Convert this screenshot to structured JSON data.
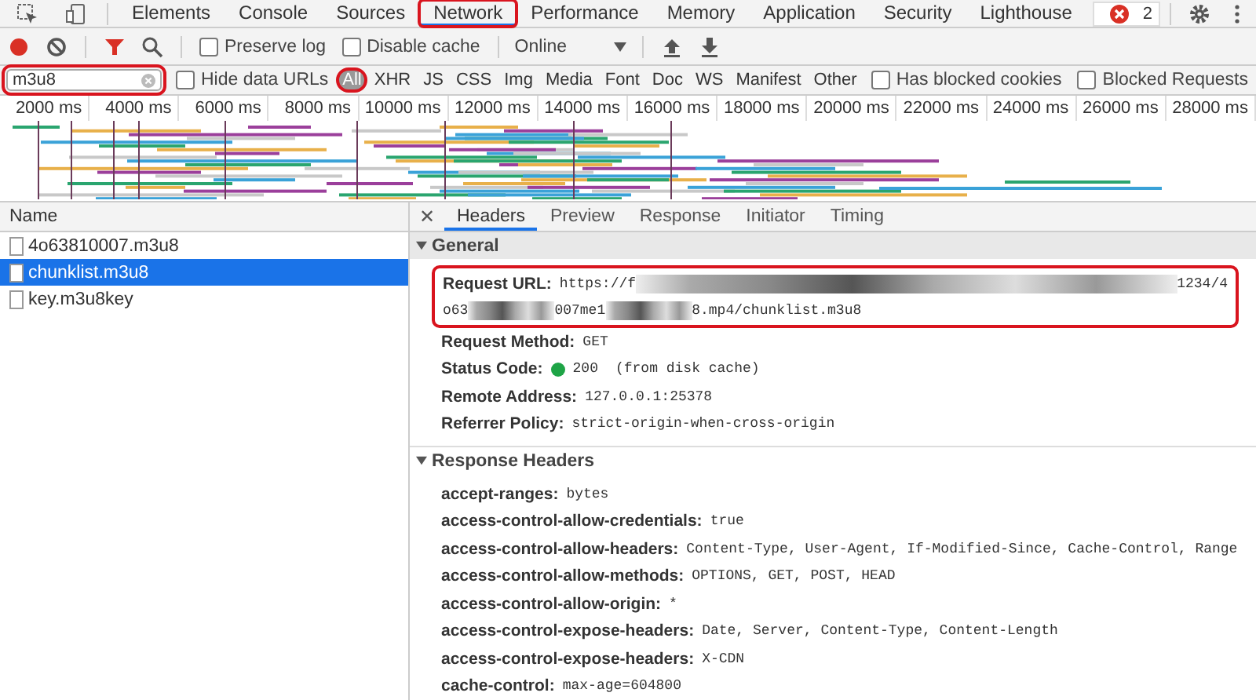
{
  "top_tabs": [
    {
      "label": "Elements",
      "selected": false,
      "annotated": false
    },
    {
      "label": "Console",
      "selected": false,
      "annotated": false
    },
    {
      "label": "Sources",
      "selected": false,
      "annotated": false
    },
    {
      "label": "Network",
      "selected": true,
      "annotated": true
    },
    {
      "label": "Performance",
      "selected": false,
      "annotated": false
    },
    {
      "label": "Memory",
      "selected": false,
      "annotated": false
    },
    {
      "label": "Application",
      "selected": false,
      "annotated": false
    },
    {
      "label": "Security",
      "selected": false,
      "annotated": false
    },
    {
      "label": "Lighthouse",
      "selected": false,
      "annotated": false
    }
  ],
  "error_badge": {
    "count": "2"
  },
  "toolbar": {
    "recording": true,
    "filter_active": true,
    "checkboxes": [
      {
        "label": "Preserve log",
        "checked": false
      },
      {
        "label": "Disable cache",
        "checked": false
      }
    ],
    "throttling": "Online"
  },
  "filter_bar": {
    "value": "m3u8",
    "annotated": true,
    "hide_data_urls": {
      "label": "Hide data URLs",
      "checked": false
    },
    "types": [
      {
        "label": "All",
        "selected": true,
        "annotated": true
      },
      {
        "label": "XHR",
        "selected": false,
        "annotated": false
      },
      {
        "label": "JS",
        "selected": false,
        "annotated": false
      },
      {
        "label": "CSS",
        "selected": false,
        "annotated": false
      },
      {
        "label": "Img",
        "selected": false,
        "annotated": false
      },
      {
        "label": "Media",
        "selected": false,
        "annotated": false
      },
      {
        "label": "Font",
        "selected": false,
        "annotated": false
      },
      {
        "label": "Doc",
        "selected": false,
        "annotated": false
      },
      {
        "label": "WS",
        "selected": false,
        "annotated": false
      },
      {
        "label": "Manifest",
        "selected": false,
        "annotated": false
      },
      {
        "label": "Other",
        "selected": false,
        "annotated": false
      }
    ],
    "checkboxes": [
      {
        "label": "Has blocked cookies",
        "checked": false
      },
      {
        "label": "Blocked Requests",
        "checked": false
      }
    ]
  },
  "timeline": {
    "ticks": [
      "2000 ms",
      "4000 ms",
      "6000 ms",
      "8000 ms",
      "10000 ms",
      "12000 ms",
      "14000 ms",
      "16000 ms",
      "18000 ms",
      "20000 ms",
      "22000 ms",
      "24000 ms",
      "26000 ms",
      "28000 ms"
    ]
  },
  "requests": {
    "column": "Name",
    "rows": [
      {
        "name": "4o63810007.m3u8",
        "selected": false
      },
      {
        "name": "chunklist.m3u8",
        "selected": true
      },
      {
        "name": "key.m3u8key",
        "selected": false
      }
    ]
  },
  "detail": {
    "close_label": "✕",
    "tabs": [
      {
        "label": "Headers",
        "selected": true
      },
      {
        "label": "Preview",
        "selected": false
      },
      {
        "label": "Response",
        "selected": false
      },
      {
        "label": "Initiator",
        "selected": false
      },
      {
        "label": "Timing",
        "selected": false
      }
    ],
    "sections": [
      {
        "title": "General",
        "expanded": true,
        "rows": [
          {
            "kind": "url",
            "key": "Request URL:",
            "annotated": true,
            "lines": [
              [
                {
                  "kind": "text",
                  "text": "https://f"
                },
                {
                  "kind": "redacted"
                },
                {
                  "kind": "text",
                  "text": "1234/4"
                }
              ],
              [
                {
                  "kind": "text",
                  "text": "o63"
                },
                {
                  "kind": "redacted"
                },
                {
                  "kind": "text",
                  "text": "007me1"
                },
                {
                  "kind": "redacted"
                },
                {
                  "kind": "text",
                  "text": "8.mp4/chunklist.m3u8"
                }
              ]
            ]
          },
          {
            "kind": "plain",
            "key": "Request Method:",
            "value": "GET"
          },
          {
            "kind": "status",
            "key": "Status Code:",
            "value": "200",
            "note": "(from disk cache)",
            "color": "#1ea446"
          },
          {
            "kind": "plain",
            "key": "Remote Address:",
            "value": "127.0.0.1:25378"
          },
          {
            "kind": "plain",
            "key": "Referrer Policy:",
            "value": "strict-origin-when-cross-origin"
          }
        ]
      },
      {
        "title": "Response Headers",
        "expanded": true,
        "rows": [
          {
            "kind": "plain",
            "key": "accept-ranges:",
            "value": "bytes"
          },
          {
            "kind": "plain",
            "key": "access-control-allow-credentials:",
            "value": "true"
          },
          {
            "kind": "plain",
            "key": "access-control-allow-headers:",
            "value": "Content-Type, User-Agent, If-Modified-Since, Cache-Control, Range"
          },
          {
            "kind": "plain",
            "key": "access-control-allow-methods:",
            "value": "OPTIONS, GET, POST, HEAD"
          },
          {
            "kind": "plain",
            "key": "access-control-allow-origin:",
            "value": "*"
          },
          {
            "kind": "plain",
            "key": "access-control-expose-headers:",
            "value": "Date, Server, Content-Type, Content-Length"
          },
          {
            "kind": "plain",
            "key": "access-control-expose-headers:",
            "value": "X-CDN"
          },
          {
            "kind": "plain",
            "key": "cache-control:",
            "value": "max-age=604800"
          }
        ]
      }
    ]
  }
}
